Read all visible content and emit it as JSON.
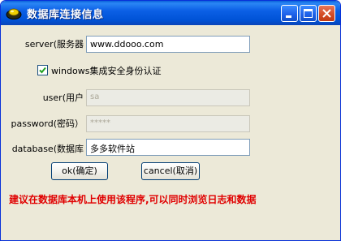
{
  "window": {
    "title": "数据库连接信息",
    "controls": {
      "minimize": "minimize-icon",
      "maximize": "maximize-icon",
      "close": "close-icon"
    }
  },
  "form": {
    "server": {
      "label": "server(服务器",
      "value": "www.ddooo.com"
    },
    "windows_auth": {
      "label": "windows集成安全身份认证",
      "checked": true
    },
    "user": {
      "label": "user(用户",
      "value": "sa"
    },
    "password": {
      "label": "password(密码）",
      "value": "*****"
    },
    "database": {
      "label": "database(数据库",
      "value": "多多软件站"
    }
  },
  "buttons": {
    "ok": "ok(确定)",
    "cancel": "cancel(取消)"
  },
  "notice": "建议在数据库本机上使用该程序,可以同时浏览日志和数据",
  "colors": {
    "title_bar": "#0052d6",
    "dialog_bg": "#ece9d8",
    "notice_text": "#e00000",
    "close_button": "#d24a24"
  }
}
